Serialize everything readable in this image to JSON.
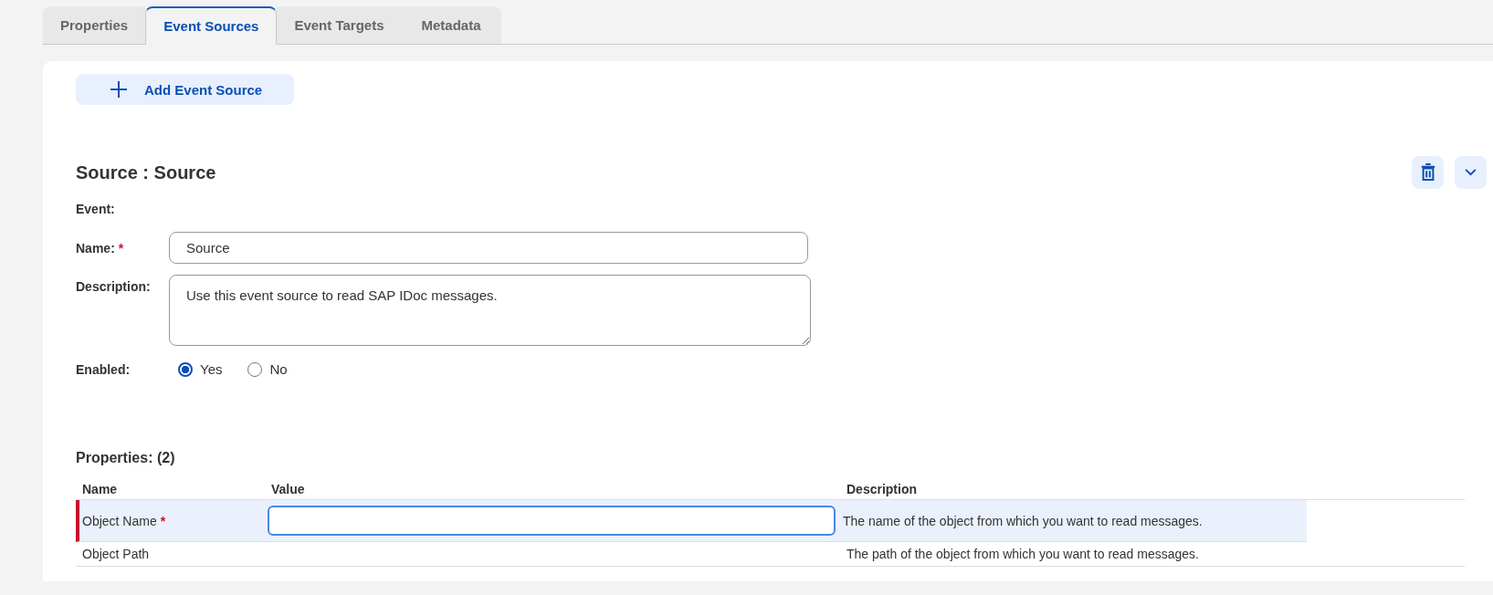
{
  "tabs": [
    {
      "label": "Properties",
      "selected": false
    },
    {
      "label": "Event Sources",
      "selected": true
    },
    {
      "label": "Event Targets",
      "selected": false
    },
    {
      "label": "Metadata",
      "selected": false
    }
  ],
  "add_button": {
    "label": "Add Event Source"
  },
  "source": {
    "title": "Source : Source",
    "event_label": "Event:",
    "name": {
      "label": "Name:",
      "required_mark": "*",
      "value": "Source"
    },
    "description": {
      "label": "Description:",
      "value": "Use this event source to read SAP IDoc messages."
    },
    "enabled": {
      "label": "Enabled:",
      "options": [
        {
          "label": "Yes",
          "selected": true
        },
        {
          "label": "No",
          "selected": false
        }
      ]
    }
  },
  "properties": {
    "title": "Properties: (2)",
    "columns": [
      "Name",
      "Value",
      "Description"
    ],
    "rows": [
      {
        "name": "Object Name",
        "required_mark": "*",
        "selected": true,
        "description": "The name of the object from which you want to read messages."
      },
      {
        "name": "Object Path",
        "selected": false,
        "description": "The path of the object from which you want to read messages."
      }
    ]
  }
}
